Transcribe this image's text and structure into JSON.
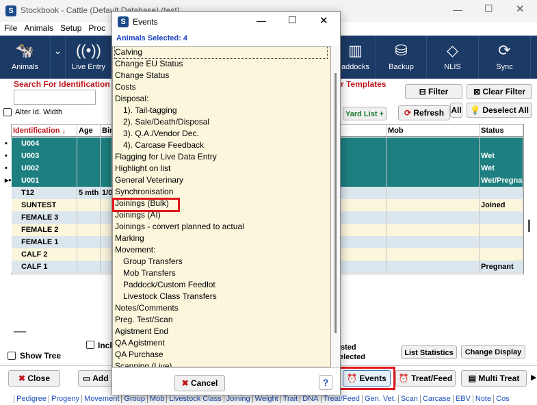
{
  "app": {
    "title": "Stockbook - Cattle (Default Database) (test)",
    "menu": [
      "File",
      "Animals",
      "Setup",
      "Proc"
    ],
    "toolbar": [
      {
        "label": "Animals",
        "icon": "cow-icon"
      },
      {
        "label": "Live Entry",
        "icon": "radio-signal-icon"
      },
      {
        "label": "addocks",
        "icon": "fence-icon"
      },
      {
        "label": "Backup",
        "icon": "database-icon"
      },
      {
        "label": "NLIS",
        "icon": "nlis-icon"
      },
      {
        "label": "Sync",
        "icon": "sync-icon"
      }
    ],
    "search_label": "Search For Identification",
    "alter_id_label": "Alter Id. Width",
    "templates_label": "r Templates",
    "filter_label": "Filter",
    "clear_filter_label": "Clear Filter",
    "yard_list_label": "Yard List +",
    "refresh_label": "Refresh",
    "all_label": "All",
    "deselect_all_label": "Deselect All",
    "columns": [
      "Identification",
      "Age",
      "Bir",
      "Mob",
      "Status"
    ],
    "rows": [
      {
        "marker": "•",
        "id": "U004",
        "age": "",
        "bir": "",
        "mob": "",
        "status": "",
        "style": "sel"
      },
      {
        "marker": "•",
        "id": "U003",
        "age": "",
        "bir": "",
        "mob": "",
        "status": "Wet",
        "style": "sel"
      },
      {
        "marker": "•",
        "id": "U002",
        "age": "",
        "bir": "",
        "mob": "",
        "status": "Wet",
        "style": "sel"
      },
      {
        "marker": "▸•",
        "id": "U001",
        "age": "",
        "bir": "",
        "mob": "",
        "status": "Wet/Pregnan",
        "style": "sel"
      },
      {
        "marker": "",
        "id": "T12",
        "age": "5 mth",
        "bir": "1/0",
        "mob": "",
        "status": "",
        "style": "blu"
      },
      {
        "marker": "",
        "id": "SUNTEST",
        "age": "",
        "bir": "",
        "mob": "",
        "status": "Joined",
        "style": "yel"
      },
      {
        "marker": "",
        "id": "FEMALE 3",
        "age": "",
        "bir": "",
        "mob": "",
        "status": "",
        "style": "blu"
      },
      {
        "marker": "",
        "id": "FEMALE 2",
        "age": "",
        "bir": "",
        "mob": "",
        "status": "",
        "style": "yel"
      },
      {
        "marker": "",
        "id": "FEMALE 1",
        "age": "",
        "bir": "",
        "mob": "",
        "status": "",
        "style": "blu"
      },
      {
        "marker": "",
        "id": "CALF 2",
        "age": "",
        "bir": "",
        "mob": "",
        "status": "",
        "style": "yel"
      },
      {
        "marker": "",
        "id": "CALF 1",
        "age": "",
        "bir": "",
        "mob": "",
        "status": "Pregnant",
        "style": "blu"
      }
    ],
    "show_tree_label": "Show Tree",
    "incl_label": "Incl",
    "selected_text_1": "sted",
    "selected_text_2": "elected",
    "list_statistics_label": "List Statistics",
    "change_display_label": "Change Display",
    "close_label": "Close",
    "add_label": "Add",
    "events_label": "Events",
    "treat_feed_label": "Treat/Feed",
    "multi_treat_label": "Multi Treat",
    "bottom_links": [
      "Pedigree",
      "Progeny",
      "Movement",
      "Group",
      "Mob",
      "Livestock Class",
      "Joining",
      "Weight",
      "Trait",
      "DNA",
      "Treat/Feed",
      "Gen. Vet.",
      "Scan",
      "Carcase",
      "EBV",
      "Note",
      "Cos"
    ]
  },
  "dialog": {
    "title": "Events",
    "animals_selected": "Animals Selected:  4",
    "items": [
      {
        "label": "Calving",
        "indent": 0
      },
      {
        "label": "Change EU Status",
        "indent": 0
      },
      {
        "label": "Change Status",
        "indent": 0
      },
      {
        "label": "Costs",
        "indent": 0
      },
      {
        "label": "Disposal:",
        "indent": 0
      },
      {
        "label": "1).  Tail-tagging",
        "indent": 1
      },
      {
        "label": "2).  Sale/Death/Disposal",
        "indent": 1
      },
      {
        "label": "3).  Q.A./Vendor Dec.",
        "indent": 1
      },
      {
        "label": "4).  Carcase Feedback",
        "indent": 1
      },
      {
        "label": "Flagging for Live Data Entry",
        "indent": 0
      },
      {
        "label": "Highlight on list",
        "indent": 0
      },
      {
        "label": "General Veterinary",
        "indent": 0
      },
      {
        "label": "Synchronisation",
        "indent": 0
      },
      {
        "label": "Joinings (Bulk)",
        "indent": 0
      },
      {
        "label": "Joinings (AI)",
        "indent": 0
      },
      {
        "label": "Joinings - convert planned to actual",
        "indent": 0
      },
      {
        "label": "Marking",
        "indent": 0
      },
      {
        "label": "Movement:",
        "indent": 0
      },
      {
        "label": "Group Transfers",
        "indent": 1
      },
      {
        "label": "Mob Transfers",
        "indent": 1
      },
      {
        "label": "Paddock/Custom Feedlot",
        "indent": 1
      },
      {
        "label": "Livestock Class Transfers",
        "indent": 1
      },
      {
        "label": "Notes/Comments",
        "indent": 0
      },
      {
        "label": "Preg. Test/Scan",
        "indent": 0
      },
      {
        "label": "Agistment End",
        "indent": 0
      },
      {
        "label": "QA Agistment",
        "indent": 0
      },
      {
        "label": "QA Purchase",
        "indent": 0
      },
      {
        "label": "Scanning (Live)",
        "indent": 0
      }
    ],
    "highlighted_item": "Joinings (Bulk)",
    "cancel_label": "Cancel",
    "help_label": "?"
  }
}
